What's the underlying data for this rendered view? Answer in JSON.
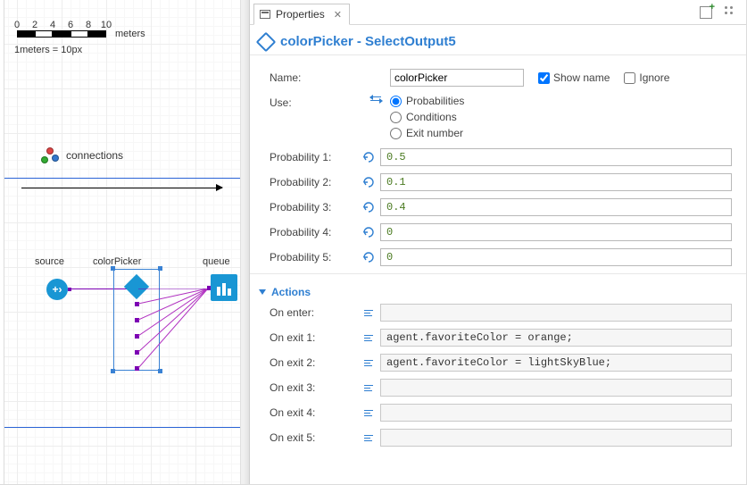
{
  "canvas": {
    "ruler": {
      "t0": "0",
      "t2": "2",
      "t4": "4",
      "t6": "6",
      "t8": "8",
      "t10": "10",
      "unit": "meters",
      "note": "1meters = 10px"
    },
    "connections_label": "connections",
    "source_label": "source",
    "colorpicker_label": "colorPicker",
    "queue_label": "queue",
    "source_glyph": "+›"
  },
  "tabs": {
    "properties": "Properties"
  },
  "header": {
    "title": "colorPicker - SelectOutput5"
  },
  "form": {
    "name_label": "Name:",
    "name_value": "colorPicker",
    "show_name": "Show name",
    "ignore": "Ignore",
    "use_label": "Use:",
    "use_options": {
      "prob": "Probabilities",
      "cond": "Conditions",
      "exit": "Exit number"
    },
    "prob_labels": {
      "p1": "Probability 1:",
      "p2": "Probability 2:",
      "p3": "Probability 3:",
      "p4": "Probability 4:",
      "p5": "Probability 5:"
    },
    "prob_values": {
      "p1": "0.5",
      "p2": "0.1",
      "p3": "0.4",
      "p4": "0",
      "p5": "0"
    }
  },
  "actions": {
    "section": "Actions",
    "on_enter_label": "On enter:",
    "on_enter": "",
    "on_exit1_label": "On exit 1:",
    "on_exit1": "agent.favoriteColor = orange;",
    "on_exit2_label": "On exit 2:",
    "on_exit2": "agent.favoriteColor = lightSkyBlue;",
    "on_exit3_label": "On exit 3:",
    "on_exit3": "",
    "on_exit4_label": "On exit 4:",
    "on_exit4": "",
    "on_exit5_label": "On exit 5:",
    "on_exit5": ""
  }
}
